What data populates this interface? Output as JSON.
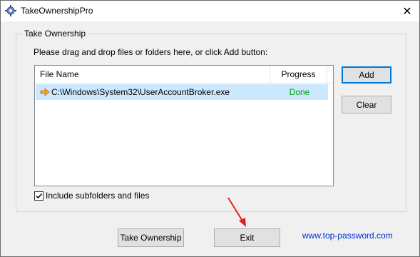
{
  "window": {
    "title": "TakeOwnershipPro",
    "close_glyph": "✕"
  },
  "group": {
    "legend": "Take Ownership",
    "instructions": "Please drag and drop files or folders here, or click Add button:"
  },
  "list": {
    "columns": [
      "File Name",
      "Progress"
    ],
    "rows": [
      {
        "file": "C:\\Windows\\System32\\UserAccountBroker.exe",
        "progress": "Done",
        "icon": "arrow-right-icon"
      }
    ]
  },
  "buttons": {
    "add": "Add",
    "clear": "Clear",
    "take_ownership": "Take Ownership",
    "exit": "Exit"
  },
  "options": {
    "include_subfolders_label": "Include subfolders and files",
    "include_subfolders_checked": true
  },
  "footer": {
    "link": "www.top-password.com"
  },
  "colors": {
    "selected_row": "#cce8ff",
    "done_text": "#00a000",
    "link": "#0033cc",
    "annotation_arrow": "#e02020"
  }
}
